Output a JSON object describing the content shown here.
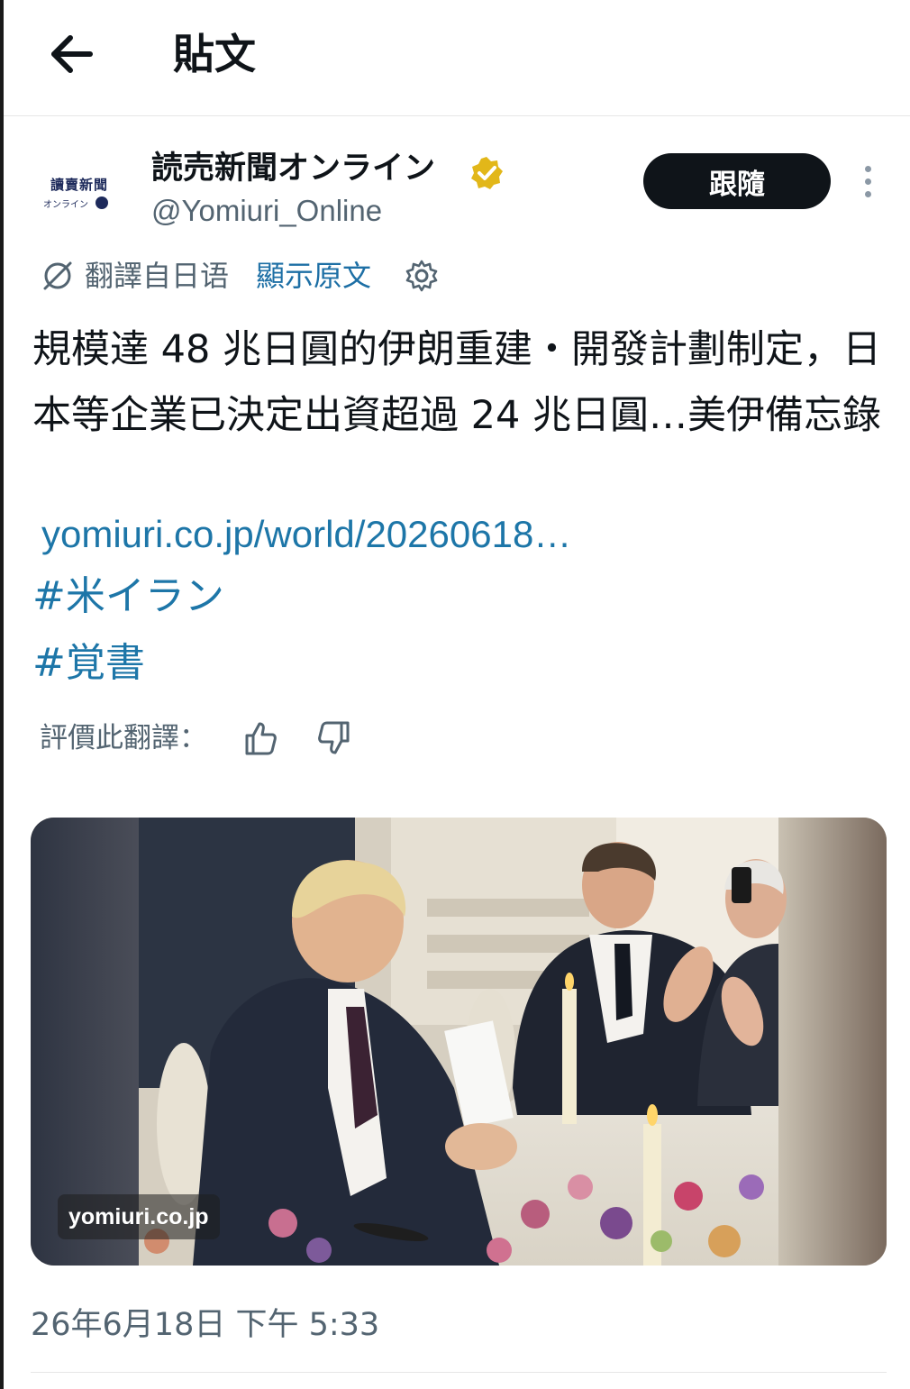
{
  "header": {
    "title": "貼文",
    "back_icon": "arrow-left-icon"
  },
  "author": {
    "display_name": "読売新聞オンライン",
    "handle": "@Yomiuri_Online",
    "verified": true,
    "verified_color": "#e2b719",
    "avatar_logo_text": "讀賣新聞",
    "avatar_logo_subtext": "オンライン"
  },
  "follow_button": {
    "label": "跟隨"
  },
  "translation": {
    "translated_from": "翻譯自日语",
    "show_original": "顯示原文",
    "icon": "translate-icon",
    "settings_icon": "gear-icon"
  },
  "tweet": {
    "text": "規模達 48 兆日圓的伊朗重建・開發計劃制定，日本等企業已決定出資超過 24 兆日圓…美伊備忘錄",
    "link": "yomiuri.co.jp/world/20260618…",
    "hashtags": [
      "#米イラン",
      "#覚書"
    ]
  },
  "rating": {
    "label": "評價此翻譯：",
    "thumbs_up_icon": "thumbs-up-icon",
    "thumbs_down_icon": "thumbs-down-icon"
  },
  "media": {
    "watermark": "yomiuri.co.jp"
  },
  "timestamp": "26年6月18日 下午 5:33",
  "colors": {
    "link": "#1d76a8",
    "secondary_text": "#536471",
    "follow_bg": "#0f1419"
  }
}
